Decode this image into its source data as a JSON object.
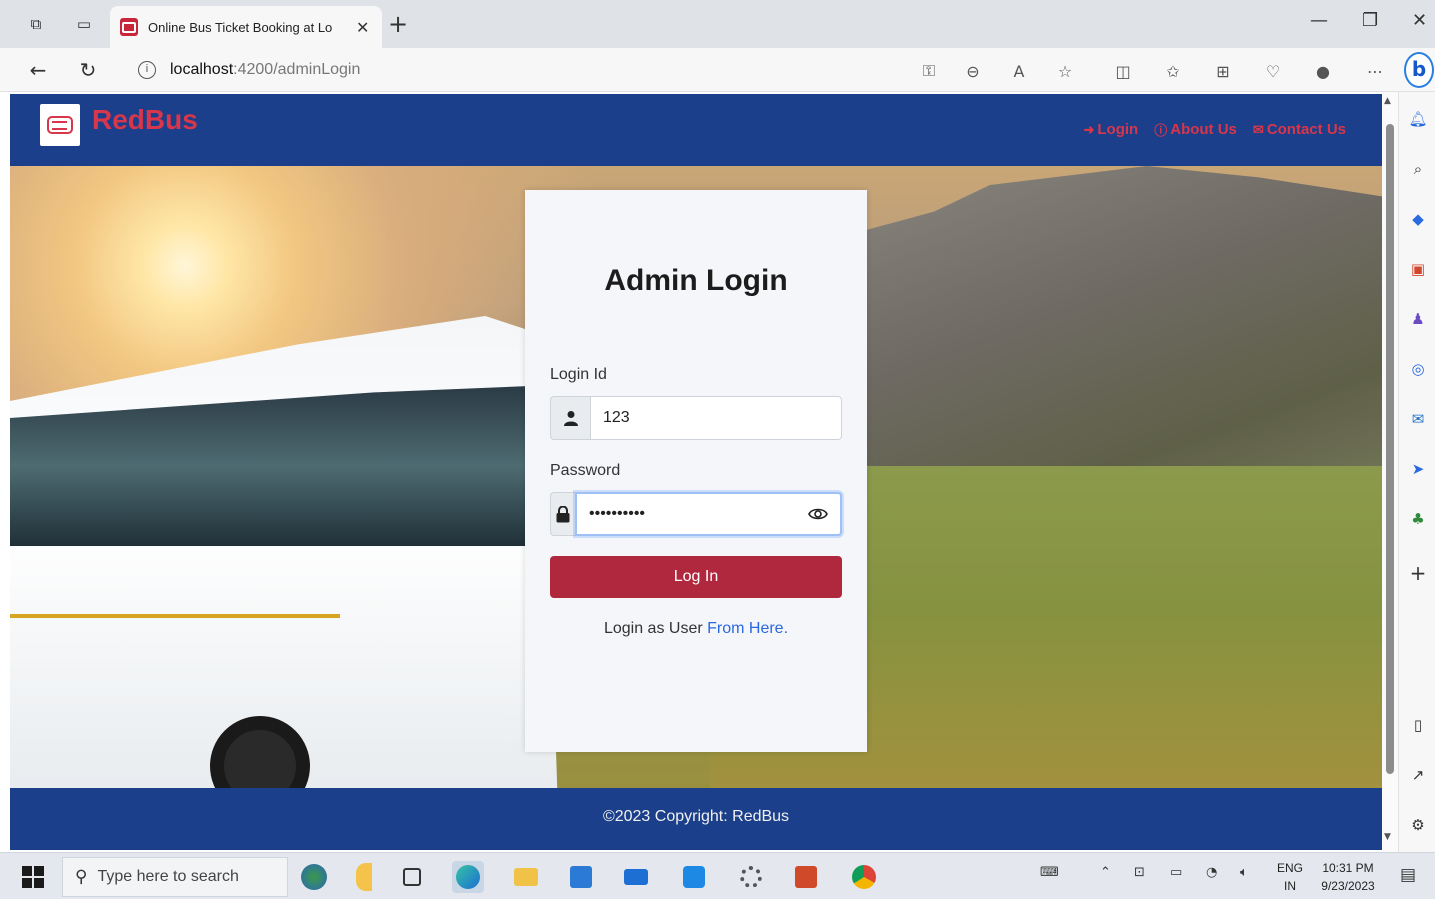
{
  "browser": {
    "tab_title": "Online Bus Ticket Booking at Lo",
    "url_host": "localhost",
    "url_path": ":4200/adminLogin"
  },
  "site": {
    "brand": "RedBus",
    "nav": [
      {
        "label": "Login",
        "icon": "sign-in-icon"
      },
      {
        "label": "About Us",
        "icon": "info-circle-icon"
      },
      {
        "label": "Contact Us",
        "icon": "envelope-icon"
      }
    ],
    "footer": "©2023 Copyright: RedBus"
  },
  "login": {
    "title": "Admin Login",
    "login_id_label": "Login Id",
    "login_id_value": "123",
    "password_label": "Password",
    "password_value": "••••••••••",
    "submit": "Log In",
    "user_prefix": "Login as User",
    "user_link": "From Here."
  },
  "taskbar": {
    "search_placeholder": "Type here to search",
    "lang_line1": "ENG",
    "lang_line2": "IN",
    "time": "10:31 PM",
    "date": "9/23/2023"
  },
  "colors": {
    "navbar": "#1b3f8a",
    "brand_red": "#d8364a",
    "button_red": "#b0283d",
    "link_blue": "#2a68e0"
  }
}
